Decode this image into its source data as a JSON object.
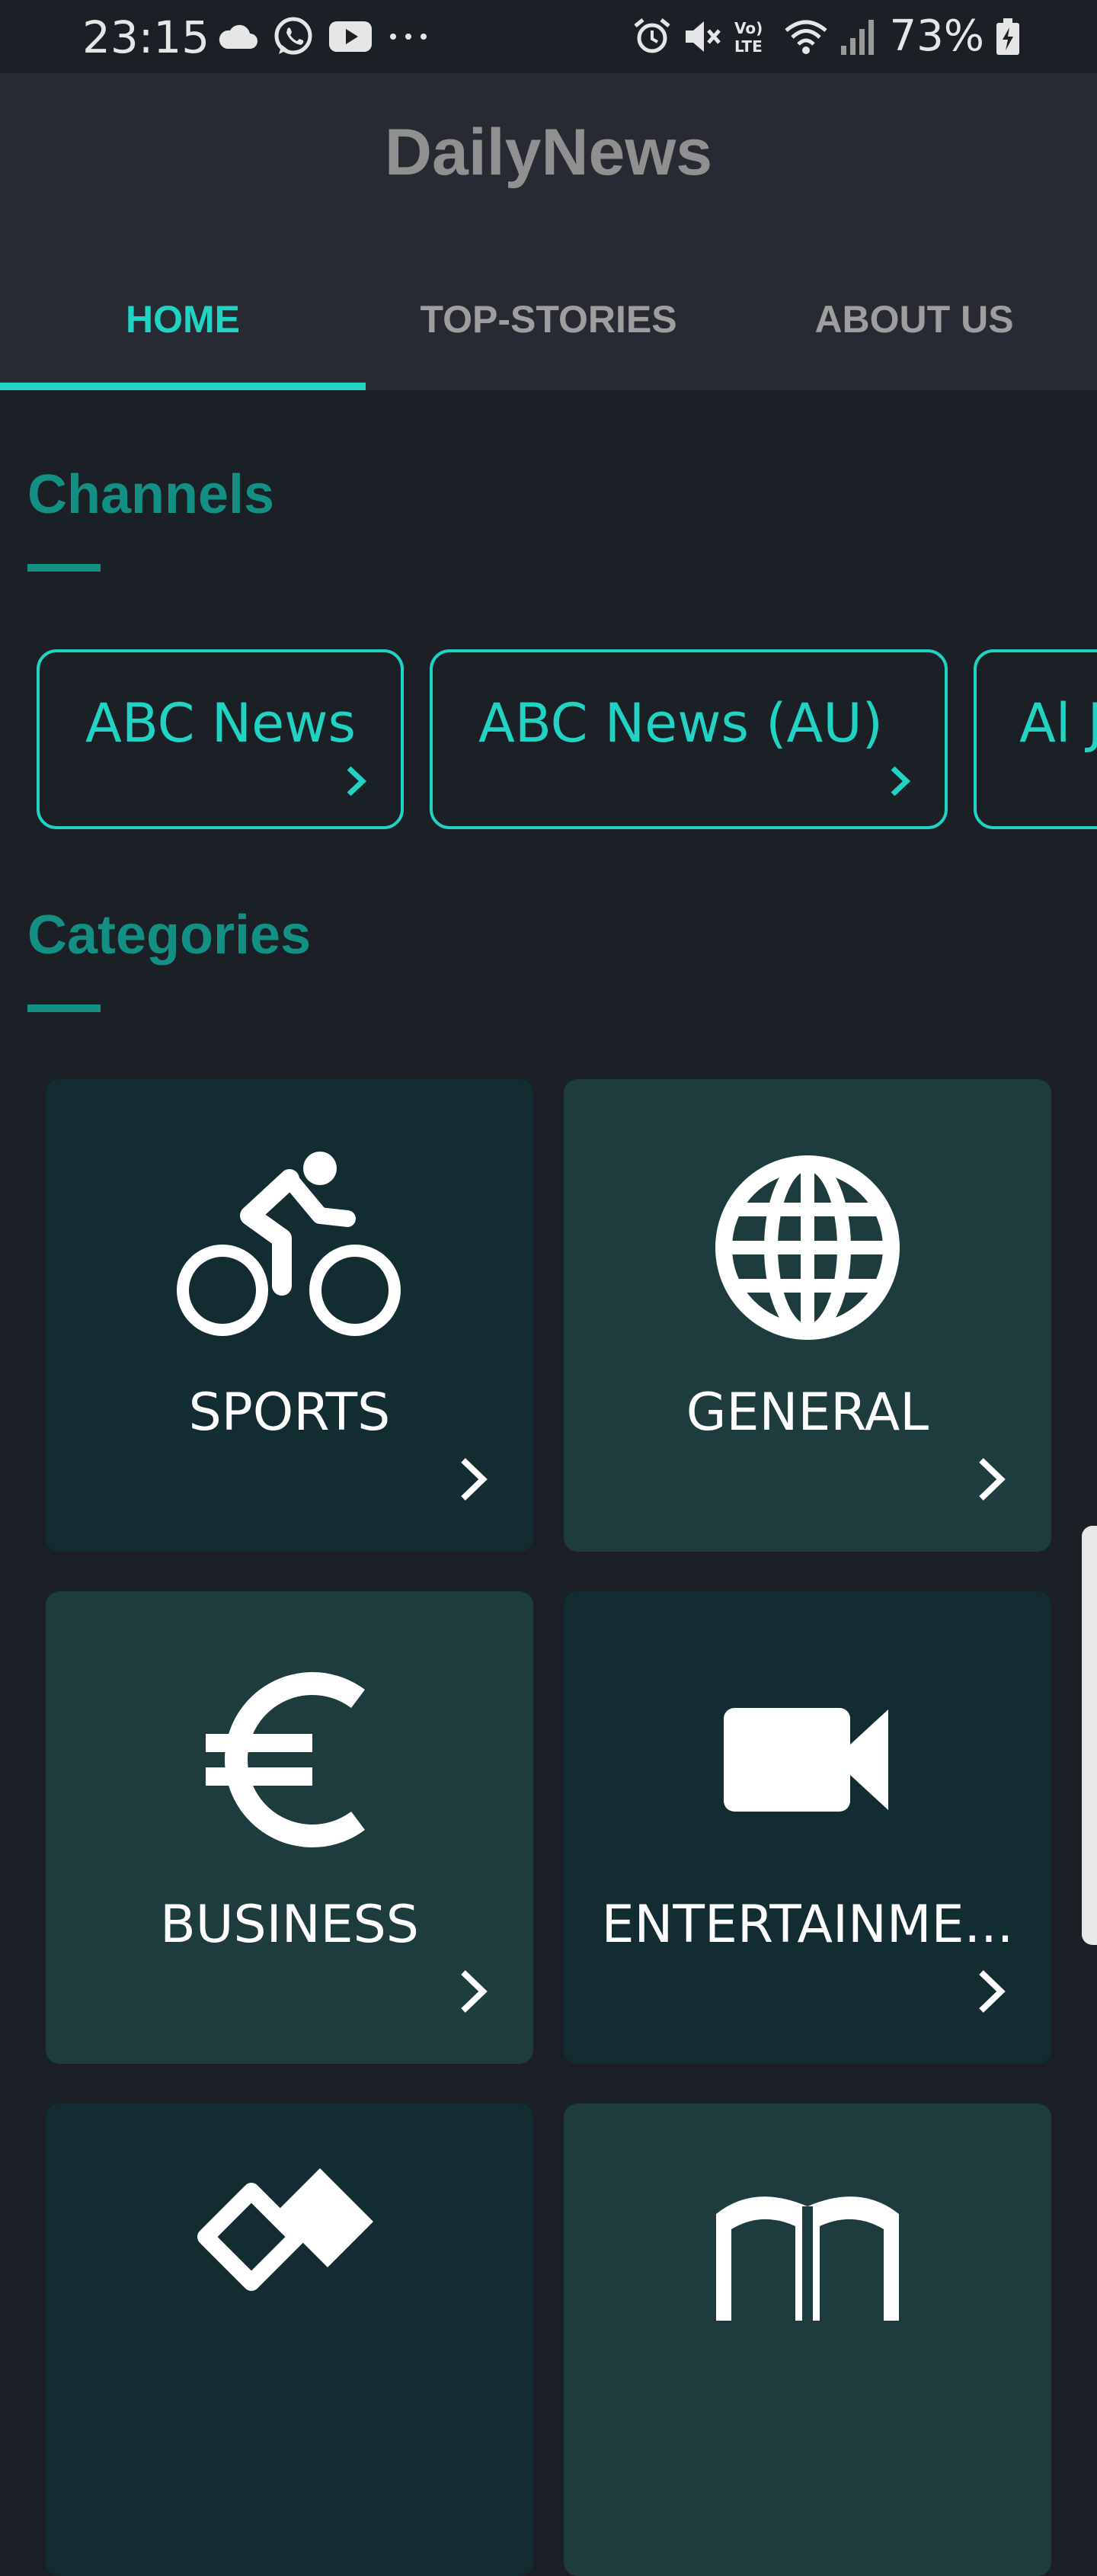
{
  "status_bar": {
    "time": "23:15",
    "left_icons": [
      "cloud-icon",
      "whatsapp-icon",
      "youtube-icon",
      "more-dots-icon"
    ],
    "right_icons": [
      "alarm-icon",
      "mute-icon",
      "volte-icon",
      "wifi-icon",
      "signal-icon",
      "battery-charging-icon"
    ],
    "volte_text": "Vo) LTE",
    "battery_percent": "73%"
  },
  "app": {
    "title": "DailyNews",
    "accent_color": "#20d3c2",
    "heading_color": "#138f84"
  },
  "tabs": [
    {
      "label": "HOME",
      "active": true
    },
    {
      "label": "TOP-STORIES",
      "active": false
    },
    {
      "label": "ABOUT US",
      "active": false
    }
  ],
  "channels": {
    "title": "Channels",
    "items": [
      {
        "label": "ABC News"
      },
      {
        "label": "ABC News (AU)"
      },
      {
        "label": "Al J"
      }
    ]
  },
  "categories": {
    "title": "Categories",
    "items": [
      {
        "label": "SPORTS",
        "icon": "bicycle-icon"
      },
      {
        "label": "GENERAL",
        "icon": "globe-icon"
      },
      {
        "label": "BUSINESS",
        "icon": "euro-icon"
      },
      {
        "label": "ENTERTAINME...",
        "icon": "video-camera-icon"
      },
      {
        "label": "",
        "icon": "health-icon"
      },
      {
        "label": "",
        "icon": "science-book-icon"
      }
    ]
  }
}
